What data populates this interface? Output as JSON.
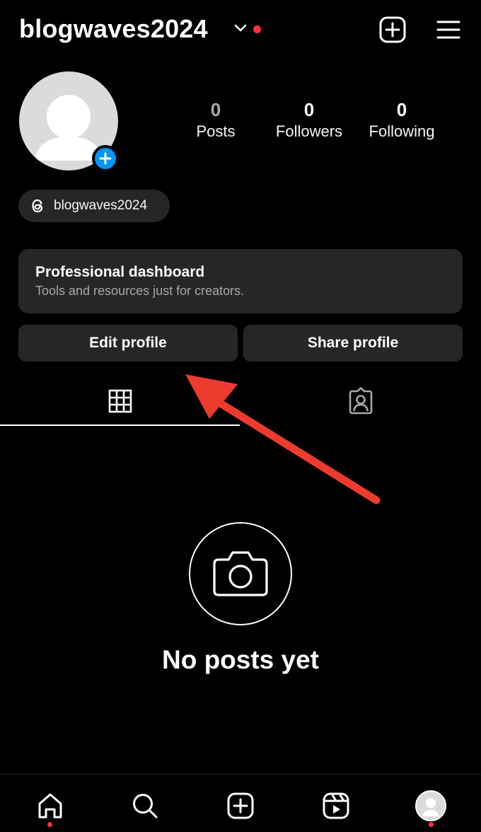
{
  "header": {
    "username": "blogwaves2024",
    "icons": [
      "chevron-down-icon",
      "notification-dot",
      "new-post-icon",
      "menu-icon"
    ]
  },
  "profile": {
    "avatar_icon": "default-avatar-icon",
    "stats": [
      {
        "value": "0",
        "label": "Posts"
      },
      {
        "value": "0",
        "label": "Followers"
      },
      {
        "value": "0",
        "label": "Following"
      }
    ],
    "threads_handle": "blogwaves2024"
  },
  "dashboard": {
    "title": "Professional dashboard",
    "subtitle": "Tools and resources just for creators."
  },
  "actions": {
    "edit_label": "Edit profile",
    "share_label": "Share profile"
  },
  "tabs": [
    {
      "icon": "grid-icon",
      "active": true
    },
    {
      "icon": "tagged-icon",
      "active": false
    }
  ],
  "empty_state": {
    "icon": "camera-icon",
    "title": "No posts yet"
  },
  "annotation": {
    "color": "#ee3b2f",
    "type": "arrow"
  },
  "bottom_nav": [
    "home-icon",
    "search-icon",
    "create-icon",
    "reels-icon",
    "profile-icon"
  ],
  "colors": {
    "background": "#000000",
    "surface": "#262626",
    "accent_blue": "#0095f6",
    "notification_red": "#ff3040"
  }
}
